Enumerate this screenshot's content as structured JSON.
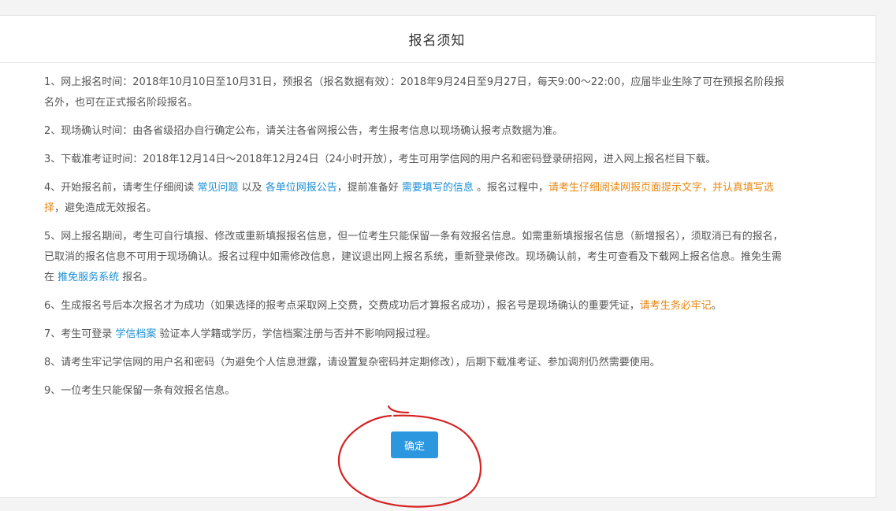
{
  "panel": {
    "title": "报名须知"
  },
  "notices": {
    "n1": {
      "text": "1、网上报名时间：2018年10月10日至10月31日，预报名（报名数据有效）：2018年9月24日至9月27日，每天9:00～22:00，应届毕业生除了可在预报名阶段报名外，也可在正式报名阶段报名。"
    },
    "n2": {
      "text": "2、现场确认时间：由各省级招办自行确定公布，请关注各省网报公告，考生报考信息以现场确认报考点数据为准。"
    },
    "n3": {
      "text": "3、下载准考证时间：2018年12月14日～2018年12月24日（24小时开放），考生可用学信网的用户名和密码登录研招网，进入网上报名栏目下载。"
    },
    "n4": {
      "p1": "4、开始报名前，请考生仔细阅读 ",
      "link1": "常见问题",
      "p2": " 以及 ",
      "link2": "各单位网报公告",
      "p3": "，提前准备好 ",
      "link3": "需要填写的信息",
      "p4": " 。报名过程中，",
      "highlight": "请考生仔细阅读网报页面提示文字，并认真填写选择",
      "p5": "，避免造成无效报名。"
    },
    "n5": {
      "p1": "5、网上报名期间，考生可自行填报、修改或重新填报报名信息，但一位考生只能保留一条有效报名信息。如需重新填报报名信息（新增报名），须取消已有的报名，已取消的报名信息不可用于现场确认。报名过程中如需修改信息，建议退出网上报名系统，重新登录修改。现场确认前，考生可查看及下载网上报名信息。推免生需在 ",
      "link": "推免服务系统",
      "p2": " 报名。"
    },
    "n6": {
      "p1": "6、生成报名号后本次报名才为成功（如果选择的报考点采取网上交费，交费成功后才算报名成功），报名号是现场确认的重要凭证，",
      "highlight": "请考生务必牢记",
      "p2": "。"
    },
    "n7": {
      "p1": "7、考生可登录 ",
      "link": "学信档案",
      "p2": " 验证本人学籍或学历，学信档案注册与否并不影响网报过程。"
    },
    "n8": {
      "text": "8、请考生牢记学信网的用户名和密码（为避免个人信息泄露，请设置复杂密码并定期修改），后期下载准考证、参加调剂仍然需要使用。"
    },
    "n9": {
      "text": "9、一位考生只能保留一条有效报名信息。"
    }
  },
  "confirm_button": {
    "label": "确定"
  },
  "colors": {
    "link": "#1a8fd6",
    "highlight": "#e8860f",
    "button": "#2b97df",
    "annotation": "#d62020"
  }
}
